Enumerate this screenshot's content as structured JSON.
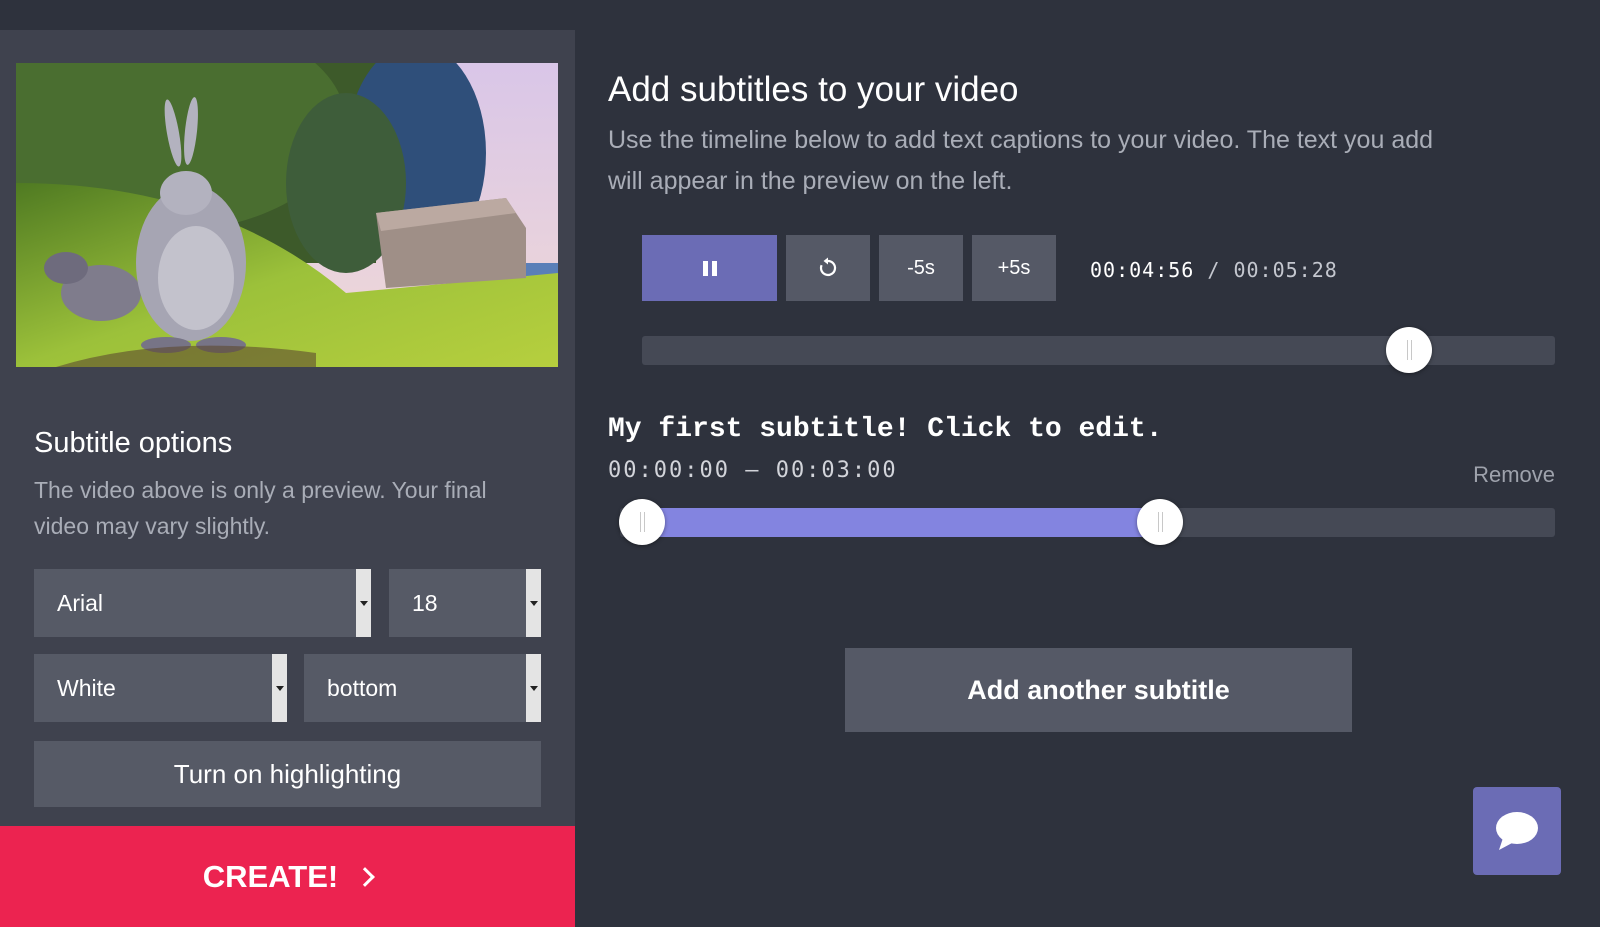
{
  "options": {
    "title": "Subtitle options",
    "description": "The video above is only a preview. Your final video may vary slightly.",
    "font": "Arial",
    "size": "18",
    "color": "White",
    "position": "bottom",
    "highlight_label": "Turn on highlighting"
  },
  "create_label": "CREATE!",
  "main": {
    "title": "Add subtitles to your video",
    "description": "Use the timeline below to add text captions to your video. The text you add will appear in the preview on the left."
  },
  "player": {
    "back_label": "-5s",
    "forward_label": "+5s",
    "current_time": "00:04:56",
    "separator": "/",
    "total_time": "00:05:28",
    "progress": 0.9024
  },
  "subtitle": {
    "text": "My first subtitle! Click to edit.",
    "range": "00:00:00 – 00:03:00",
    "remove_label": "Remove"
  },
  "add_subtitle_label": "Add another subtitle",
  "icons": {
    "pause": "pause-icon",
    "replay": "replay-icon",
    "chat": "chat-bubble-icon",
    "create_arrow": "chevron-right-icon"
  },
  "colors": {
    "accent": "#6b6cb5",
    "create": "#ec2350",
    "range_fill": "#8384e0"
  }
}
